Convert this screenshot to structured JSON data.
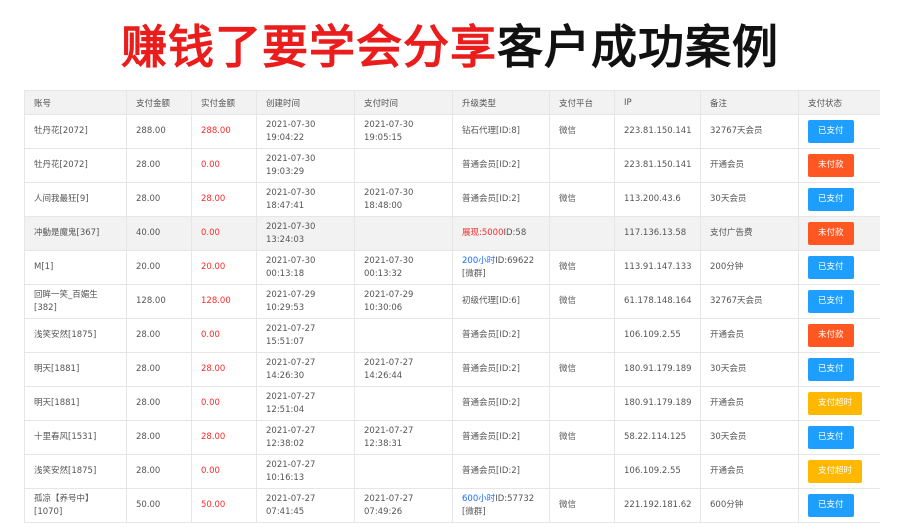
{
  "header": {
    "title_red": "赚钱了要学会分享",
    "title_black": "客户成功案例"
  },
  "table": {
    "columns": [
      "账号",
      "支付金额",
      "实付金额",
      "创建时间",
      "支付时间",
      "升级类型",
      "支付平台",
      "IP",
      "备注",
      "支付状态"
    ],
    "rows": [
      {
        "account": "牡丹花[2072]",
        "pay": "288.00",
        "actual": "288.00",
        "created": "2021-07-30 19:04:22",
        "paid": "2021-07-30 19:05:15",
        "type_accent": "",
        "type_rest": "钻石代理[ID:8]",
        "type_accent_color": "",
        "platform": "微信",
        "ip": "223.81.150.141",
        "note": "32767天会员",
        "status": "已支付",
        "status_kind": "paid"
      },
      {
        "account": "牡丹花[2072]",
        "pay": "28.00",
        "actual": "0.00",
        "created": "2021-07-30 19:03:29",
        "paid": "",
        "type_accent": "",
        "type_rest": "普通会员[ID:2]",
        "type_accent_color": "",
        "platform": "",
        "ip": "223.81.150.141",
        "note": "开通会员",
        "status": "未付款",
        "status_kind": "unpaid"
      },
      {
        "account": "人间我最狂[9]",
        "pay": "28.00",
        "actual": "28.00",
        "created": "2021-07-30 18:47:41",
        "paid": "2021-07-30 18:48:00",
        "type_accent": "",
        "type_rest": "普通会员[ID:2]",
        "type_accent_color": "",
        "platform": "微信",
        "ip": "113.200.43.6",
        "note": "30天会员",
        "status": "已支付",
        "status_kind": "paid"
      },
      {
        "account": "冲動是魔鬼[367]",
        "pay": "40.00",
        "actual": "0.00",
        "created": "2021-07-30 13:24:03",
        "paid": "",
        "type_accent": "展现:5000",
        "type_rest": "ID:58",
        "type_accent_color": "red",
        "platform": "",
        "ip": "117.136.13.58",
        "note": "支付广告费",
        "status": "未付款",
        "status_kind": "unpaid"
      },
      {
        "account": "M[1]",
        "pay": "20.00",
        "actual": "20.00",
        "created": "2021-07-30 00:13:18",
        "paid": "2021-07-30 00:13:32",
        "type_accent": "200小时",
        "type_rest": "ID:69622 [微群]",
        "type_accent_color": "blue",
        "platform": "微信",
        "ip": "113.91.147.133",
        "note": "200分钟",
        "status": "已支付",
        "status_kind": "paid"
      },
      {
        "account": "回眸一笑_百媚生[382]",
        "pay": "128.00",
        "actual": "128.00",
        "created": "2021-07-29 10:29:53",
        "paid": "2021-07-29 10:30:06",
        "type_accent": "",
        "type_rest": "初级代理[ID:6]",
        "type_accent_color": "",
        "platform": "微信",
        "ip": "61.178.148.164",
        "note": "32767天会员",
        "status": "已支付",
        "status_kind": "paid"
      },
      {
        "account": "浅笑安然[1875]",
        "pay": "28.00",
        "actual": "0.00",
        "created": "2021-07-27 15:51:07",
        "paid": "",
        "type_accent": "",
        "type_rest": "普通会员[ID:2]",
        "type_accent_color": "",
        "platform": "",
        "ip": "106.109.2.55",
        "note": "开通会员",
        "status": "未付款",
        "status_kind": "unpaid"
      },
      {
        "account": "明天[1881]",
        "pay": "28.00",
        "actual": "28.00",
        "created": "2021-07-27 14:26:30",
        "paid": "2021-07-27 14:26:44",
        "type_accent": "",
        "type_rest": "普通会员[ID:2]",
        "type_accent_color": "",
        "platform": "微信",
        "ip": "180.91.179.189",
        "note": "30天会员",
        "status": "已支付",
        "status_kind": "paid"
      },
      {
        "account": "明天[1881]",
        "pay": "28.00",
        "actual": "0.00",
        "created": "2021-07-27 12:51:04",
        "paid": "",
        "type_accent": "",
        "type_rest": "普通会员[ID:2]",
        "type_accent_color": "",
        "platform": "",
        "ip": "180.91.179.189",
        "note": "开通会员",
        "status": "支付超时",
        "status_kind": "timeout"
      },
      {
        "account": "十里春风[1531]",
        "pay": "28.00",
        "actual": "28.00",
        "created": "2021-07-27 12:38:02",
        "paid": "2021-07-27 12:38:31",
        "type_accent": "",
        "type_rest": "普通会员[ID:2]",
        "type_accent_color": "",
        "platform": "微信",
        "ip": "58.22.114.125",
        "note": "30天会员",
        "status": "已支付",
        "status_kind": "paid"
      },
      {
        "account": "浅笑安然[1875]",
        "pay": "28.00",
        "actual": "0.00",
        "created": "2021-07-27 10:16:13",
        "paid": "",
        "type_accent": "",
        "type_rest": "普通会员[ID:2]",
        "type_accent_color": "",
        "platform": "",
        "ip": "106.109.2.55",
        "note": "开通会员",
        "status": "支付超时",
        "status_kind": "timeout"
      },
      {
        "account": "孤凉【养号中】[1070]",
        "pay": "50.00",
        "actual": "50.00",
        "created": "2021-07-27 07:41:45",
        "paid": "2021-07-27 07:49:26",
        "type_accent": "600小时",
        "type_rest": "ID:57732 [微群]",
        "type_accent_color": "blue",
        "platform": "微信",
        "ip": "221.192.181.62",
        "note": "600分钟",
        "status": "已支付",
        "status_kind": "paid"
      }
    ]
  },
  "colors": {
    "title_red": "#ea1c1c",
    "amount_red": "#ff2a2a",
    "status_paid": "#1e9fff",
    "status_unpaid": "#ff5722",
    "status_timeout": "#ffb800",
    "header_bg": "#f2f2f2"
  }
}
